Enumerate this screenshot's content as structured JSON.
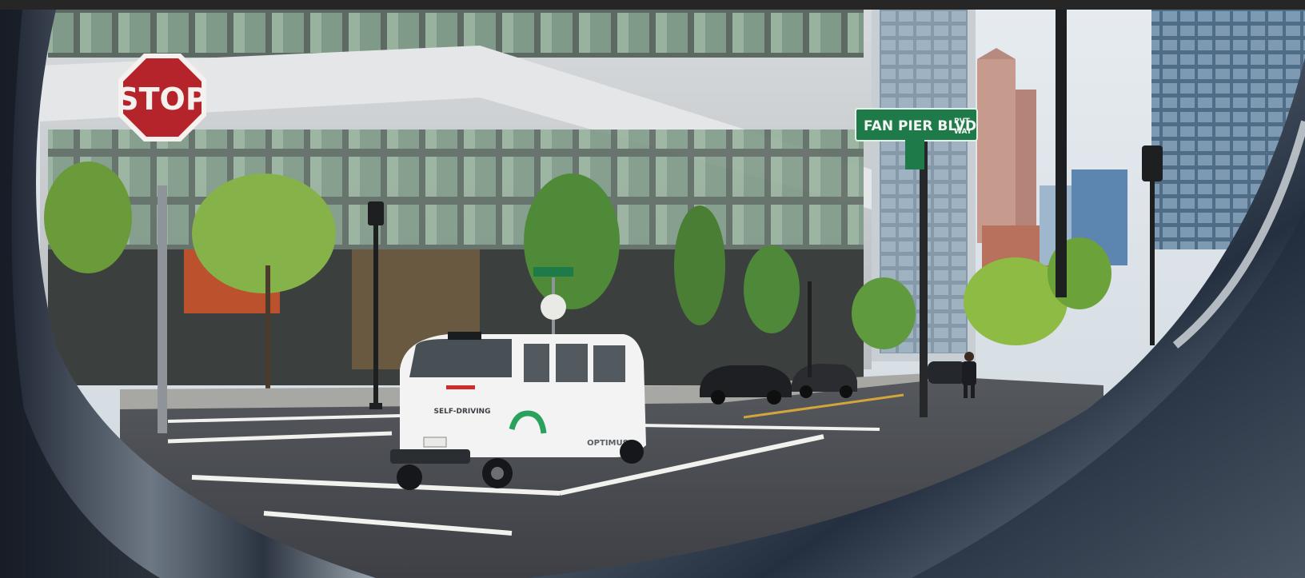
{
  "scene": {
    "stop_sign": "STOP",
    "street_sign": {
      "name": "FAN PIER BLVD",
      "suffix_top": "PVT",
      "suffix_bottom": "WAY"
    },
    "vehicle": {
      "side_text": "SELF-DRIVING",
      "brand": "OPTIMUS"
    }
  },
  "colors": {
    "stop_red": "#b5242b",
    "street_sign_green": "#1f7a4a",
    "vehicle_white": "#f2f3f2",
    "vehicle_accent_green": "#2aa15d",
    "road": "#4a4d52",
    "sky": "#dfe6ec"
  }
}
